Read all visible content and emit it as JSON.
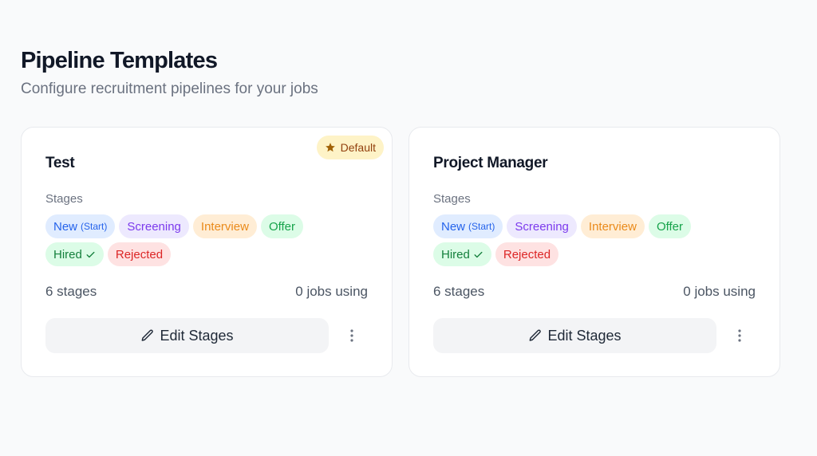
{
  "header": {
    "title": "Pipeline Templates",
    "subtitle": "Configure recruitment pipelines for your jobs"
  },
  "cards": [
    {
      "title": "Test",
      "badge": "Default",
      "stages_label": "Stages",
      "stages": {
        "new": "New",
        "new_tag": "(Start)",
        "screening": "Screening",
        "interview": "Interview",
        "offer": "Offer",
        "hired": "Hired",
        "rejected": "Rejected"
      },
      "stage_count": "6 stages",
      "jobs_using": "0 jobs using",
      "edit_label": "Edit Stages"
    },
    {
      "title": "Project Manager",
      "stages_label": "Stages",
      "stages": {
        "new": "New",
        "new_tag": "(Start)",
        "screening": "Screening",
        "interview": "Interview",
        "offer": "Offer",
        "hired": "Hired",
        "rejected": "Rejected"
      },
      "stage_count": "6 stages",
      "jobs_using": "0 jobs using",
      "edit_label": "Edit Stages"
    }
  ],
  "icons": {
    "badge": "star-icon",
    "hired": "check-icon",
    "edit": "pencil-icon",
    "more": "more-vertical-icon"
  },
  "colors": {
    "default_badge_bg": "#fef3c7",
    "default_badge_text": "#92400e",
    "new": "#2563eb",
    "screening": "#7c3aed",
    "interview": "#ea8a1a",
    "offer": "#16a34a",
    "hired": "#15803d",
    "rejected": "#dc2626"
  }
}
